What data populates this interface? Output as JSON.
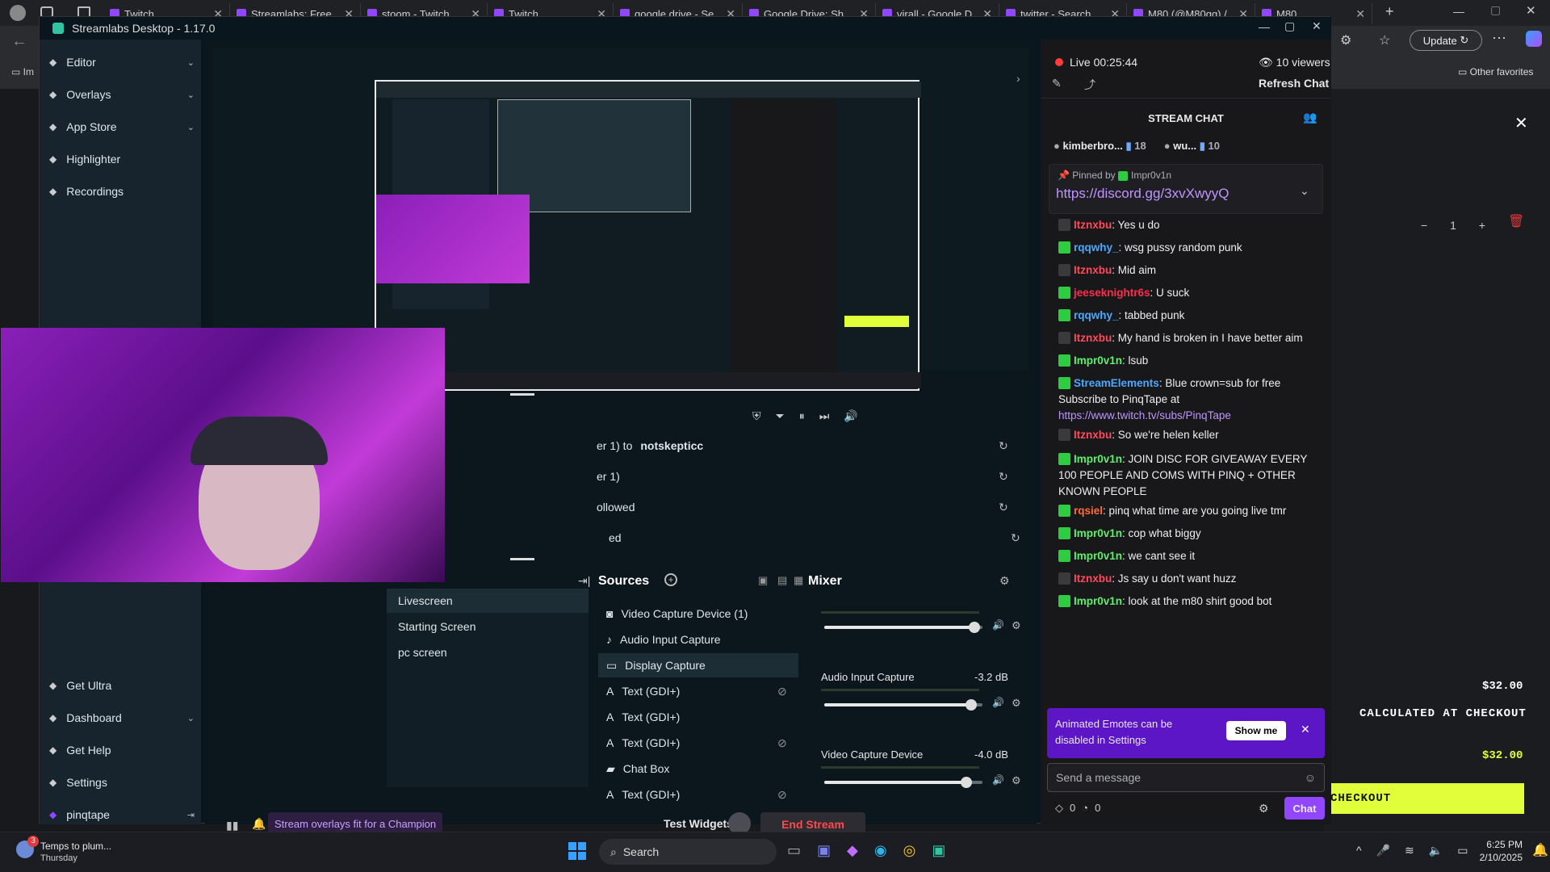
{
  "browser": {
    "tabs": [
      "Twitch",
      "Streamlabs: Free",
      "stoom - Twitch",
      "Twitch",
      "google drive - Se",
      "Google Drive: Sh",
      "virall - Google D",
      "twitter - Search",
      "M80 (@M80gg) /",
      "M80"
    ],
    "update_label": "Update",
    "bookmarks_label": "Other favorites",
    "im_label": "Im"
  },
  "slobs": {
    "title": "Streamlabs Desktop - 1.17.0",
    "nav": [
      {
        "label": "Editor",
        "chevron": true
      },
      {
        "label": "Overlays",
        "chevron": true
      },
      {
        "label": "App Store",
        "chevron": true
      },
      {
        "label": "Highlighter",
        "chevron": false
      },
      {
        "label": "Recordings",
        "chevron": false
      }
    ],
    "bottom_nav": [
      {
        "label": "Get Ultra",
        "chevron": false
      },
      {
        "label": "Dashboard",
        "chevron": true
      },
      {
        "label": "Get Help",
        "chevron": false
      },
      {
        "label": "Settings",
        "chevron": false
      },
      {
        "label": "pinqtape",
        "chevron": false
      }
    ],
    "activity": [
      {
        "text": "er 1) to ",
        "bold": "notskepticc"
      },
      {
        "text": "er 1)",
        "bold": ""
      },
      {
        "text": "ollowed",
        "bold": ""
      },
      {
        "text": "ed",
        "bold": ""
      }
    ],
    "scenes": [
      "Livescreen",
      "Starting Screen",
      "pc screen"
    ],
    "sources_title": "Sources",
    "sources": [
      {
        "label": "Video Capture Device (1)",
        "icon": "camera-icon",
        "hidden": false
      },
      {
        "label": "Audio Input Capture",
        "icon": "mic-icon",
        "hidden": false
      },
      {
        "label": "Display Capture",
        "icon": "monitor-icon",
        "hidden": false
      },
      {
        "label": "Text (GDI+)",
        "icon": "text-icon",
        "hidden": true
      },
      {
        "label": "Text (GDI+)",
        "icon": "text-icon",
        "hidden": false
      },
      {
        "label": "Text (GDI+)",
        "icon": "text-icon",
        "hidden": true
      },
      {
        "label": "Chat Box",
        "icon": "chat-icon",
        "hidden": false
      },
      {
        "label": "Text (GDI+)",
        "icon": "text-icon",
        "hidden": true
      }
    ],
    "mixer_title": "Mixer",
    "mixer": [
      {
        "name": "",
        "db": "",
        "level": 0.95
      },
      {
        "name": "Audio Input Capture",
        "db": "-3.2 dB",
        "level": 0.93
      },
      {
        "name": "Video Capture Device",
        "db": "-4.0 dB",
        "level": 0.9
      }
    ],
    "footer": {
      "promo": "Stream overlays fit for a Champion",
      "test_widgets": "Test Widgets",
      "end_stream": "End Stream"
    }
  },
  "chat": {
    "live": "Live 00:25:44",
    "viewers": "10 viewers",
    "refresh": "Refresh Chat",
    "title": "STREAM CHAT",
    "top_users": [
      {
        "name": "kimberbro...",
        "count": "18"
      },
      {
        "name": "wu...",
        "count": "10"
      }
    ],
    "pinned_by": "Pinned by",
    "pinned_user": "Impr0v1n",
    "pinned_link": "https://discord.gg/3xvXwyyQ",
    "messages": [
      {
        "user": "Itznxbu",
        "color": "#ff4a5a",
        "text": ": Yes u do"
      },
      {
        "user": "rqqwhy_",
        "color": "#4aa8ff",
        "text": ":  wsg pussy random punk"
      },
      {
        "user": "Itznxbu",
        "color": "#ff4a5a",
        "text": ": Mid aim"
      },
      {
        "user": "jeeseknightr6s",
        "color": "#ff2d4b",
        "text": ": U suck"
      },
      {
        "user": "rqqwhy_",
        "color": "#4aa8ff",
        "text": ": tabbed punk"
      },
      {
        "user": "Itznxbu",
        "color": "#ff4a5a",
        "text": ": My hand is broken in I have better aim"
      },
      {
        "user": "Impr0v1n",
        "color": "#5ef06a",
        "text": ": lsub"
      },
      {
        "user": "StreamElements",
        "color": "#4aa8ff",
        "text": ": Blue crown=sub for free Subscribe to PinqTape at",
        "link": "https://www.twitch.tv/subs/PinqTape"
      },
      {
        "user": "Itznxbu",
        "color": "#ff4a5a",
        "text": ": So we're helen keller"
      },
      {
        "user": "Impr0v1n",
        "color": "#5ef06a",
        "text": ": JOIN DISC FOR GIVEAWAY EVERY 100 PEOPLE AND COMS WITH PINQ + OTHER KNOWN PEOPLE"
      },
      {
        "user": "rqsiel",
        "color": "#ff6a3a",
        "text": ": pinq what time are you going live tmr"
      },
      {
        "user": "Impr0v1n",
        "color": "#5ef06a",
        "text": ": cop what biggy"
      },
      {
        "user": "Impr0v1n",
        "color": "#5ef06a",
        "text": ": we cant see it"
      },
      {
        "user": "Itznxbu",
        "color": "#ff4a5a",
        "text": ": Js say u don't want huzz"
      },
      {
        "user": "Impr0v1n",
        "color": "#5ef06a",
        "text": ": look at the m80 shirt good bot"
      }
    ],
    "notice": "Animated Emotes can be disabled in Settings",
    "notice_btn": "Show me",
    "placeholder": "Send a message",
    "points_a": "0",
    "points_b": "0",
    "chat_btn": "Chat"
  },
  "checkout": {
    "qty": "1",
    "price1": "$32.00",
    "shipping": "CALCULATED AT CHECKOUT",
    "price2": "$32.00",
    "button": "CHECKOUT"
  },
  "taskbar": {
    "weather_badge": "3",
    "weather_title": "Temps to plum...",
    "weather_sub": "Thursday",
    "search": "Search",
    "time": "6:25 PM",
    "date": "2/10/2025"
  },
  "colors": {
    "accent": "#9147ff",
    "checkout": "#e0ff3a",
    "end_stream": "#ff4a4a"
  }
}
